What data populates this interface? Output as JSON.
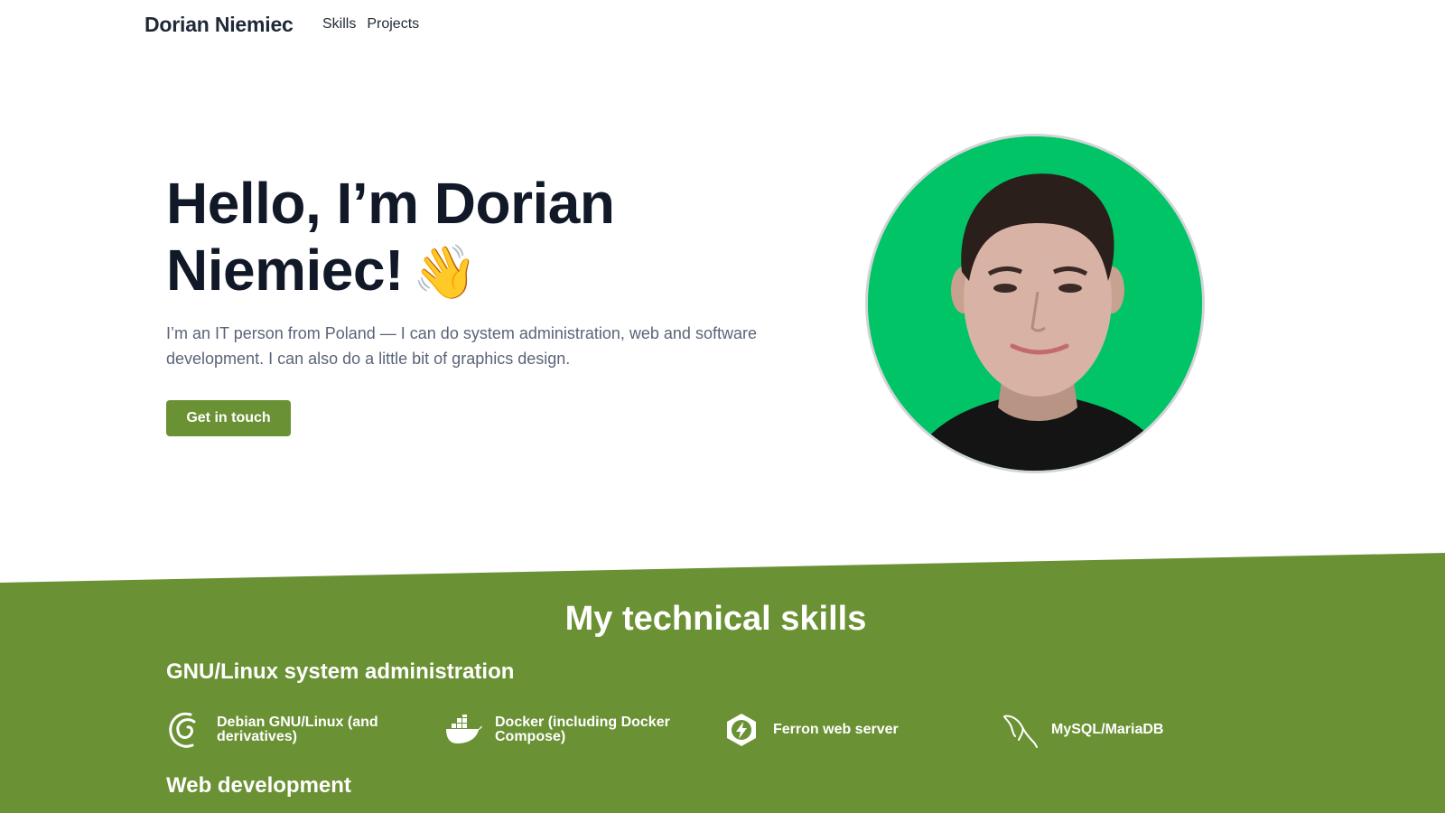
{
  "nav": {
    "brand": "Dorian Niemiec",
    "links": [
      {
        "label": "Skills"
      },
      {
        "label": "Projects"
      }
    ]
  },
  "hero": {
    "title_line1": "Hello, I’m Dorian",
    "title_line2": "Niemiec!",
    "wave_emoji": "👋",
    "description": "I’m an IT person from Poland — I can do system administration, web and software development. I can also do a little bit of graphics design.",
    "cta_label": "Get in touch"
  },
  "colors": {
    "accent_green": "#6a9133",
    "portrait_bg": "#00c466",
    "heading": "#111827",
    "body_text": "#5a6478"
  },
  "skills": {
    "title": "My technical skills",
    "categories": [
      {
        "title": "GNU/Linux system administration",
        "items": [
          {
            "label": "Debian GNU/Linux (and derivatives)",
            "icon": "debian-icon"
          },
          {
            "label": "Docker (including Docker Compose)",
            "icon": "docker-icon"
          },
          {
            "label": "Ferron web server",
            "icon": "ferron-icon"
          },
          {
            "label": "MySQL/MariaDB",
            "icon": "mysql-dolphin-icon"
          }
        ]
      },
      {
        "title": "Web development"
      }
    ]
  }
}
